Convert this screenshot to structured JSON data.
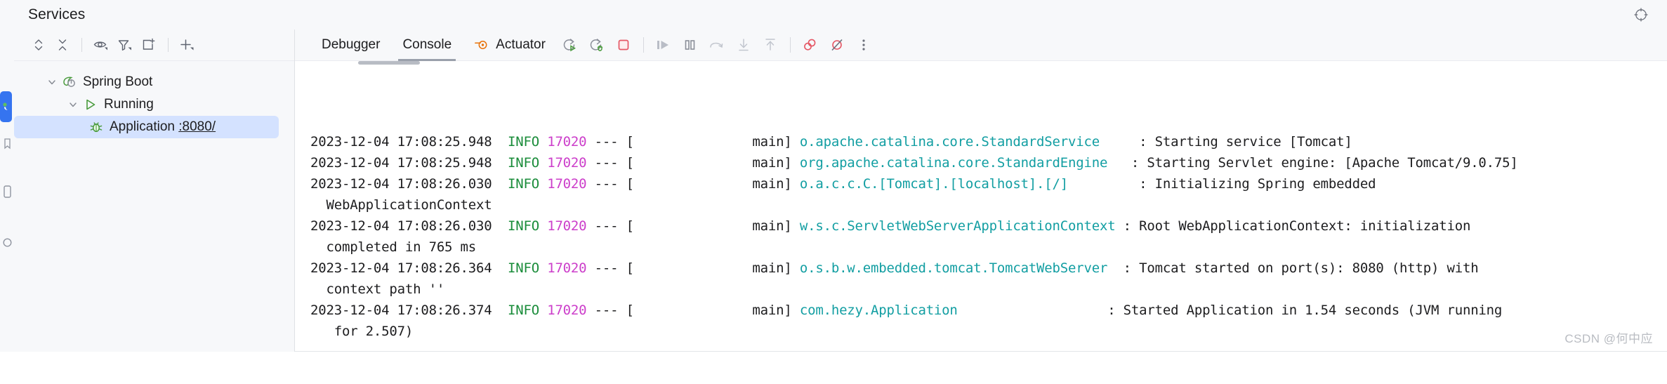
{
  "window": {
    "title": "Services",
    "settings_icon": "target-crosshair-icon"
  },
  "left_toolbar": {
    "items": [
      {
        "name": "expand-all-icon",
        "tooltip": "Expand All"
      },
      {
        "name": "collapse-all-icon",
        "tooltip": "Collapse All"
      },
      {
        "name": "eye-icon",
        "tooltip": "Show"
      },
      {
        "name": "filter-icon",
        "tooltip": "Filter"
      },
      {
        "name": "open-in-new-tab-icon",
        "tooltip": "Open in New Tab"
      },
      {
        "name": "add-icon",
        "tooltip": "Add Service"
      }
    ]
  },
  "tree": {
    "root": {
      "label": "Spring Boot",
      "icon": "spring-boot-leaf-icon",
      "expanded": true
    },
    "group": {
      "label": "Running",
      "icon": "run-triangle-icon",
      "expanded": true
    },
    "service": {
      "label": "Application",
      "port_link": ":8080/",
      "icon": "debug-bug-icon",
      "selected": true
    }
  },
  "console": {
    "tabs": [
      {
        "label": "Debugger",
        "active": false,
        "icon": null
      },
      {
        "label": "Console",
        "active": true,
        "icon": null
      },
      {
        "label": "Actuator",
        "active": false,
        "icon": "actuator-icon"
      }
    ],
    "actions": [
      {
        "name": "rerun-icon"
      },
      {
        "name": "rerun-debug-icon"
      },
      {
        "name": "stop-icon"
      },
      {
        "name": "resume-program-icon"
      },
      {
        "name": "pause-program-icon"
      },
      {
        "name": "step-over-icon"
      },
      {
        "name": "step-into-icon"
      },
      {
        "name": "step-out-icon"
      },
      {
        "name": "view-breakpoints-icon"
      },
      {
        "name": "mute-breakpoints-icon"
      },
      {
        "name": "more-options-icon"
      }
    ],
    "colors": {
      "level": "#1a8c3a",
      "pid": "#cc3eca",
      "logger": "#129ea2",
      "text": "#1d1d1f",
      "stop": "#e55765",
      "actuator": "#e8730b"
    }
  },
  "log": {
    "lines": [
      {
        "ts": "2023-12-04 17:08:25.948",
        "level": "INFO",
        "pid": "17020",
        "dash": "--- [",
        "thread": "               main]",
        "logger": "o.apache.catalina.core.StandardService",
        "pad": "     ",
        "message": ": Starting service [Tomcat]",
        "continuation": null
      },
      {
        "ts": "2023-12-04 17:08:25.948",
        "level": "INFO",
        "pid": "17020",
        "dash": "--- [",
        "thread": "               main]",
        "logger": "org.apache.catalina.core.StandardEngine",
        "pad": "   ",
        "message": ": Starting Servlet engine: [Apache Tomcat/9.0.75]",
        "continuation": null
      },
      {
        "ts": "2023-12-04 17:08:26.030",
        "level": "INFO",
        "pid": "17020",
        "dash": "--- [",
        "thread": "               main]",
        "logger": "o.a.c.c.C.[Tomcat].[localhost].[/]",
        "pad": "         ",
        "message": ": Initializing Spring embedded",
        "continuation": "  WebApplicationContext"
      },
      {
        "ts": "2023-12-04 17:08:26.030",
        "level": "INFO",
        "pid": "17020",
        "dash": "--- [",
        "thread": "               main]",
        "logger": "w.s.c.ServletWebServerApplicationContext",
        "pad": " ",
        "message": ": Root WebApplicationContext: initialization",
        "continuation": "  completed in 765 ms"
      },
      {
        "ts": "2023-12-04 17:08:26.364",
        "level": "INFO",
        "pid": "17020",
        "dash": "--- [",
        "thread": "               main]",
        "logger": "o.s.b.w.embedded.tomcat.TomcatWebServer",
        "pad": "  ",
        "message": ": Tomcat started on port(s): 8080 (http) with",
        "continuation": "  context path ''"
      },
      {
        "ts": "2023-12-04 17:08:26.374",
        "level": "INFO",
        "pid": "17020",
        "dash": "--- [",
        "thread": "               main]",
        "logger": "com.hezy.Application",
        "pad": "                   ",
        "message": ": Started Application in 1.54 seconds (JVM running",
        "continuation": "   for 2.507)"
      }
    ]
  },
  "watermark": {
    "text": "CSDN @何中应"
  }
}
